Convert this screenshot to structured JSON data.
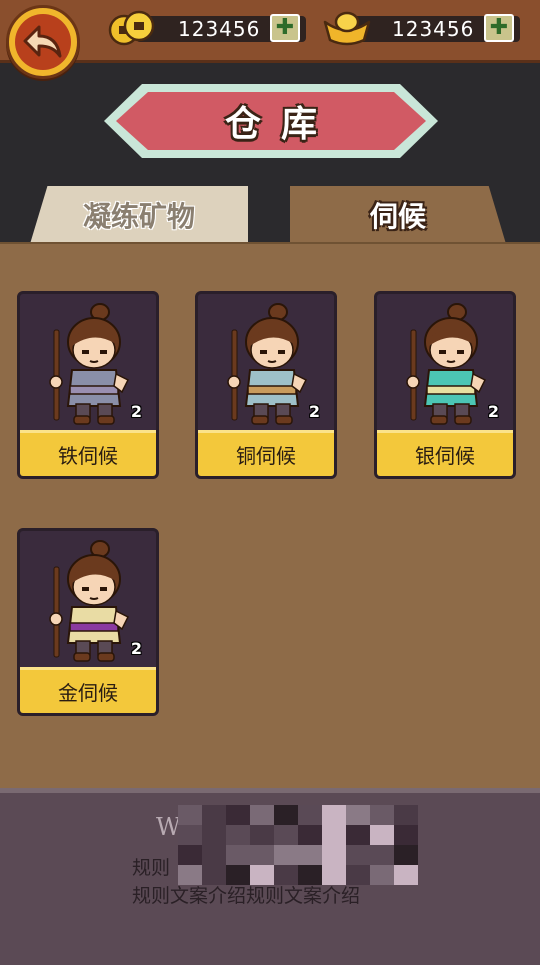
{
  "header": {
    "back_icon": "back-arrow-icon",
    "coins": {
      "icon": "coin-icon",
      "value": "123456",
      "plus_icon": "plus-icon"
    },
    "ingots": {
      "icon": "gold-ingot-icon",
      "value": "123456",
      "plus_icon": "plus-icon"
    }
  },
  "title": "仓库",
  "tabs": [
    {
      "label": "凝练矿物",
      "active": false
    },
    {
      "label": "伺候",
      "active": true
    }
  ],
  "items": [
    {
      "name": "铁伺候",
      "count": "2",
      "robe": "#8a8fa8",
      "sash": "#9a8fb0"
    },
    {
      "name": "铜伺候",
      "count": "2",
      "robe": "#9ec0c8",
      "sash": "#c99b5c"
    },
    {
      "name": "银伺候",
      "count": "2",
      "robe": "#4cc6b4",
      "sash": "#e8e0a0"
    },
    {
      "name": "金伺候",
      "count": "2",
      "robe": "#e9dca4",
      "sash": "#8a3aa0"
    }
  ],
  "footer": {
    "title": "W",
    "line1": "规则",
    "line2": "规则文案介绍规则文案介绍"
  },
  "colors": {
    "accent_gold": "#f3c83b",
    "panel_brown": "#8e6b48",
    "banner_red": "#d15a64"
  }
}
